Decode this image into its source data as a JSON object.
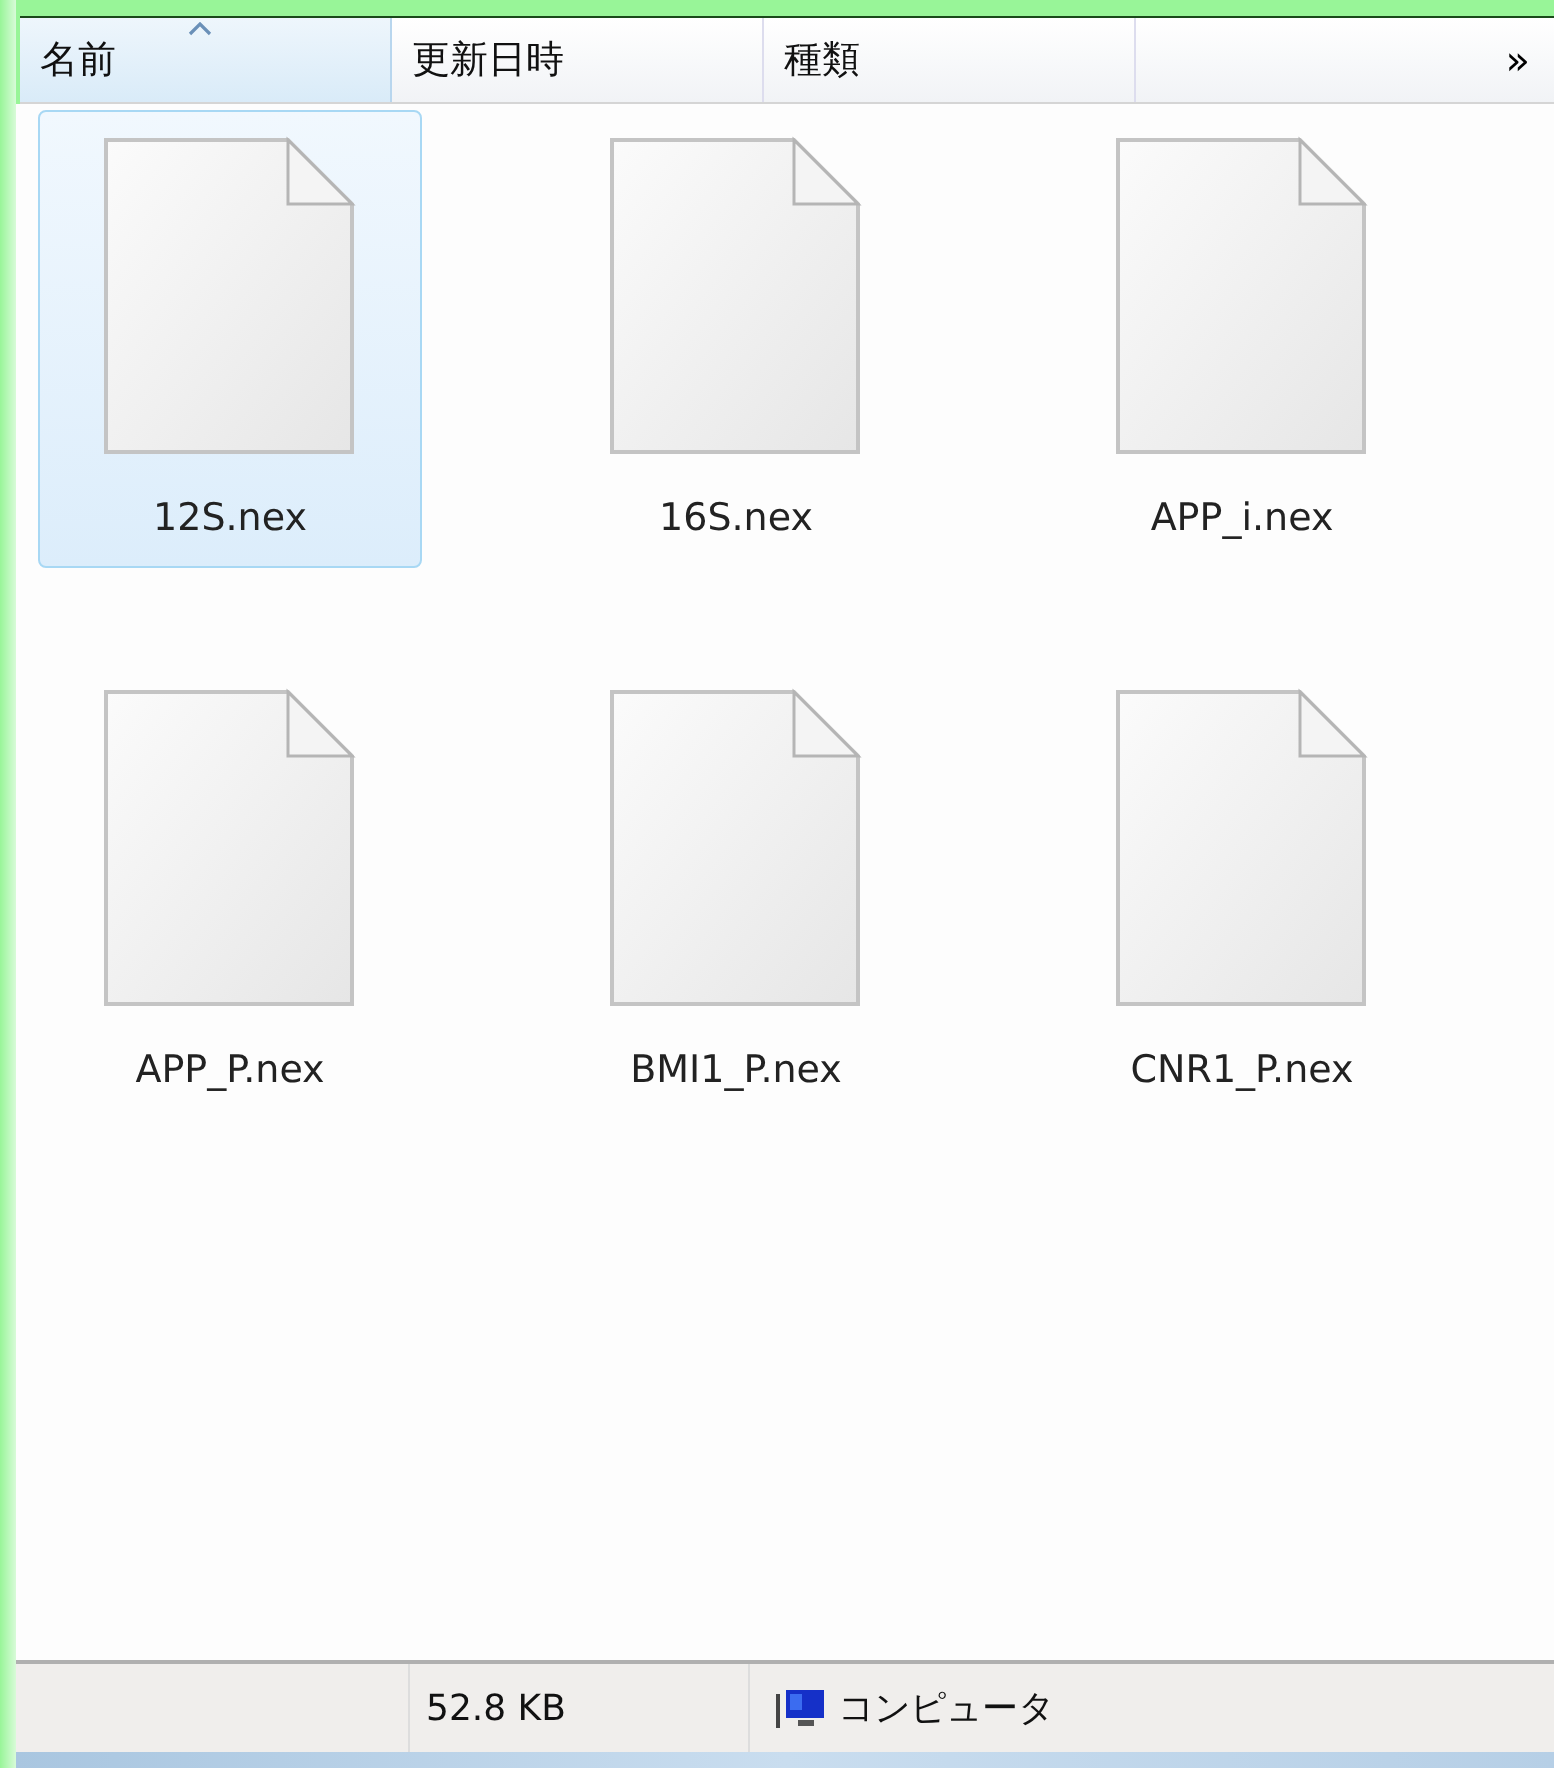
{
  "columns": [
    {
      "label": "名前",
      "selected": true,
      "sorted": true
    },
    {
      "label": "更新日時",
      "selected": false,
      "sorted": false
    },
    {
      "label": "種類",
      "selected": false,
      "sorted": false
    }
  ],
  "column_overflow": "»",
  "files": [
    {
      "name": "12S.nex",
      "selected": true
    },
    {
      "name": "16S.nex",
      "selected": false
    },
    {
      "name": "APP_i.nex",
      "selected": false
    },
    {
      "name": "APP_P.nex",
      "selected": false
    },
    {
      "name": "BMI1_P.nex",
      "selected": false
    },
    {
      "name": "CNR1_P.nex",
      "selected": false
    }
  ],
  "status_bar": {
    "size": "52.8 KB",
    "zone": "コンピュータ"
  }
}
